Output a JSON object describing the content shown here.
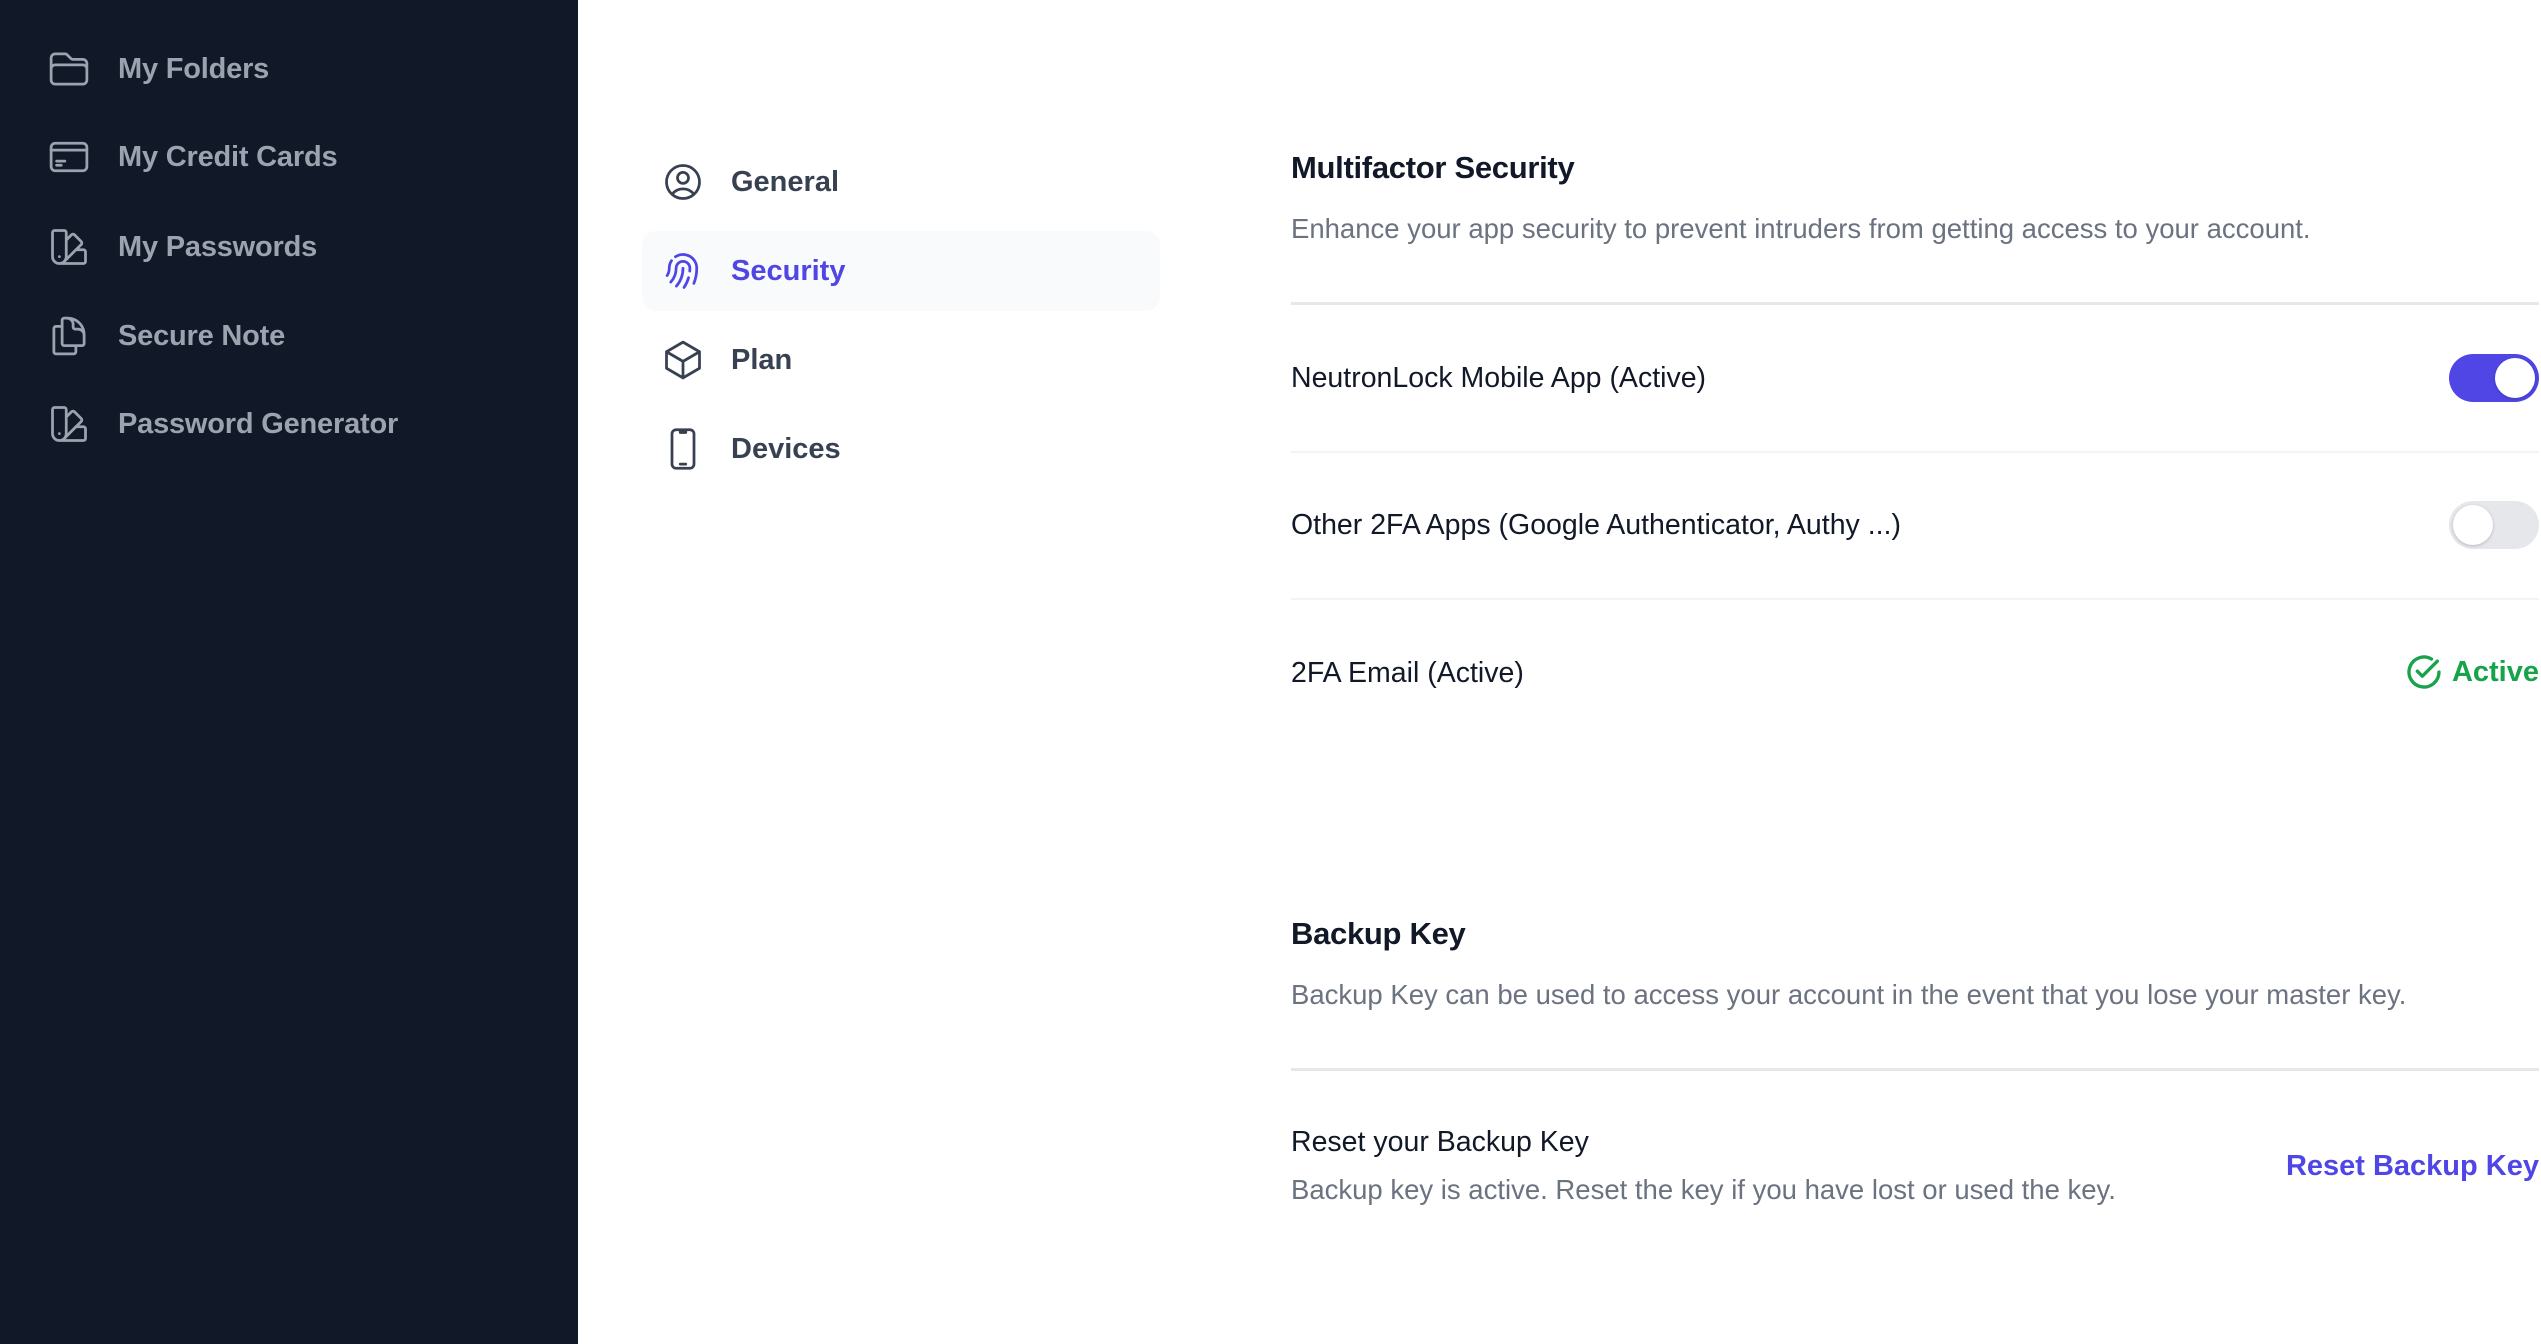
{
  "sidebar": {
    "items": [
      {
        "label": "My Folders",
        "icon": "folder-icon"
      },
      {
        "label": "My Credit Cards",
        "icon": "credit-card-icon"
      },
      {
        "label": "My Passwords",
        "icon": "swatch-icon"
      },
      {
        "label": "Secure Note",
        "icon": "document-duplicate-icon"
      },
      {
        "label": "Password Generator",
        "icon": "swatch-icon"
      }
    ]
  },
  "settings_nav": {
    "active": "Security",
    "items": [
      {
        "label": "General",
        "icon": "user-circle-icon"
      },
      {
        "label": "Security",
        "icon": "fingerprint-icon"
      },
      {
        "label": "Plan",
        "icon": "cube-icon"
      },
      {
        "label": "Devices",
        "icon": "device-phone-icon"
      }
    ]
  },
  "multifactor": {
    "title": "Multifactor Security",
    "description": "Enhance your app security to prevent intruders from getting access to your account.",
    "rows": [
      {
        "label": "NeutronLock Mobile App (Active)",
        "control": "toggle",
        "enabled": true
      },
      {
        "label": "Other 2FA Apps (Google Authenticator, Authy ...)",
        "control": "toggle",
        "enabled": false
      },
      {
        "label": "2FA Email (Active)",
        "control": "status",
        "status": "Active"
      }
    ]
  },
  "backup_key": {
    "title": "Backup Key",
    "description": "Backup Key can be used to access your account in the event that you lose your master key.",
    "reset_title": "Reset your Backup Key",
    "reset_description": "Backup key is active. Reset the key if you have lost or used the key.",
    "reset_button": "Reset Backup Key"
  },
  "colors": {
    "sidebar_bg": "#111827",
    "accent": "#4f46e5",
    "success": "#16a34a",
    "muted_text": "#6b7280"
  }
}
